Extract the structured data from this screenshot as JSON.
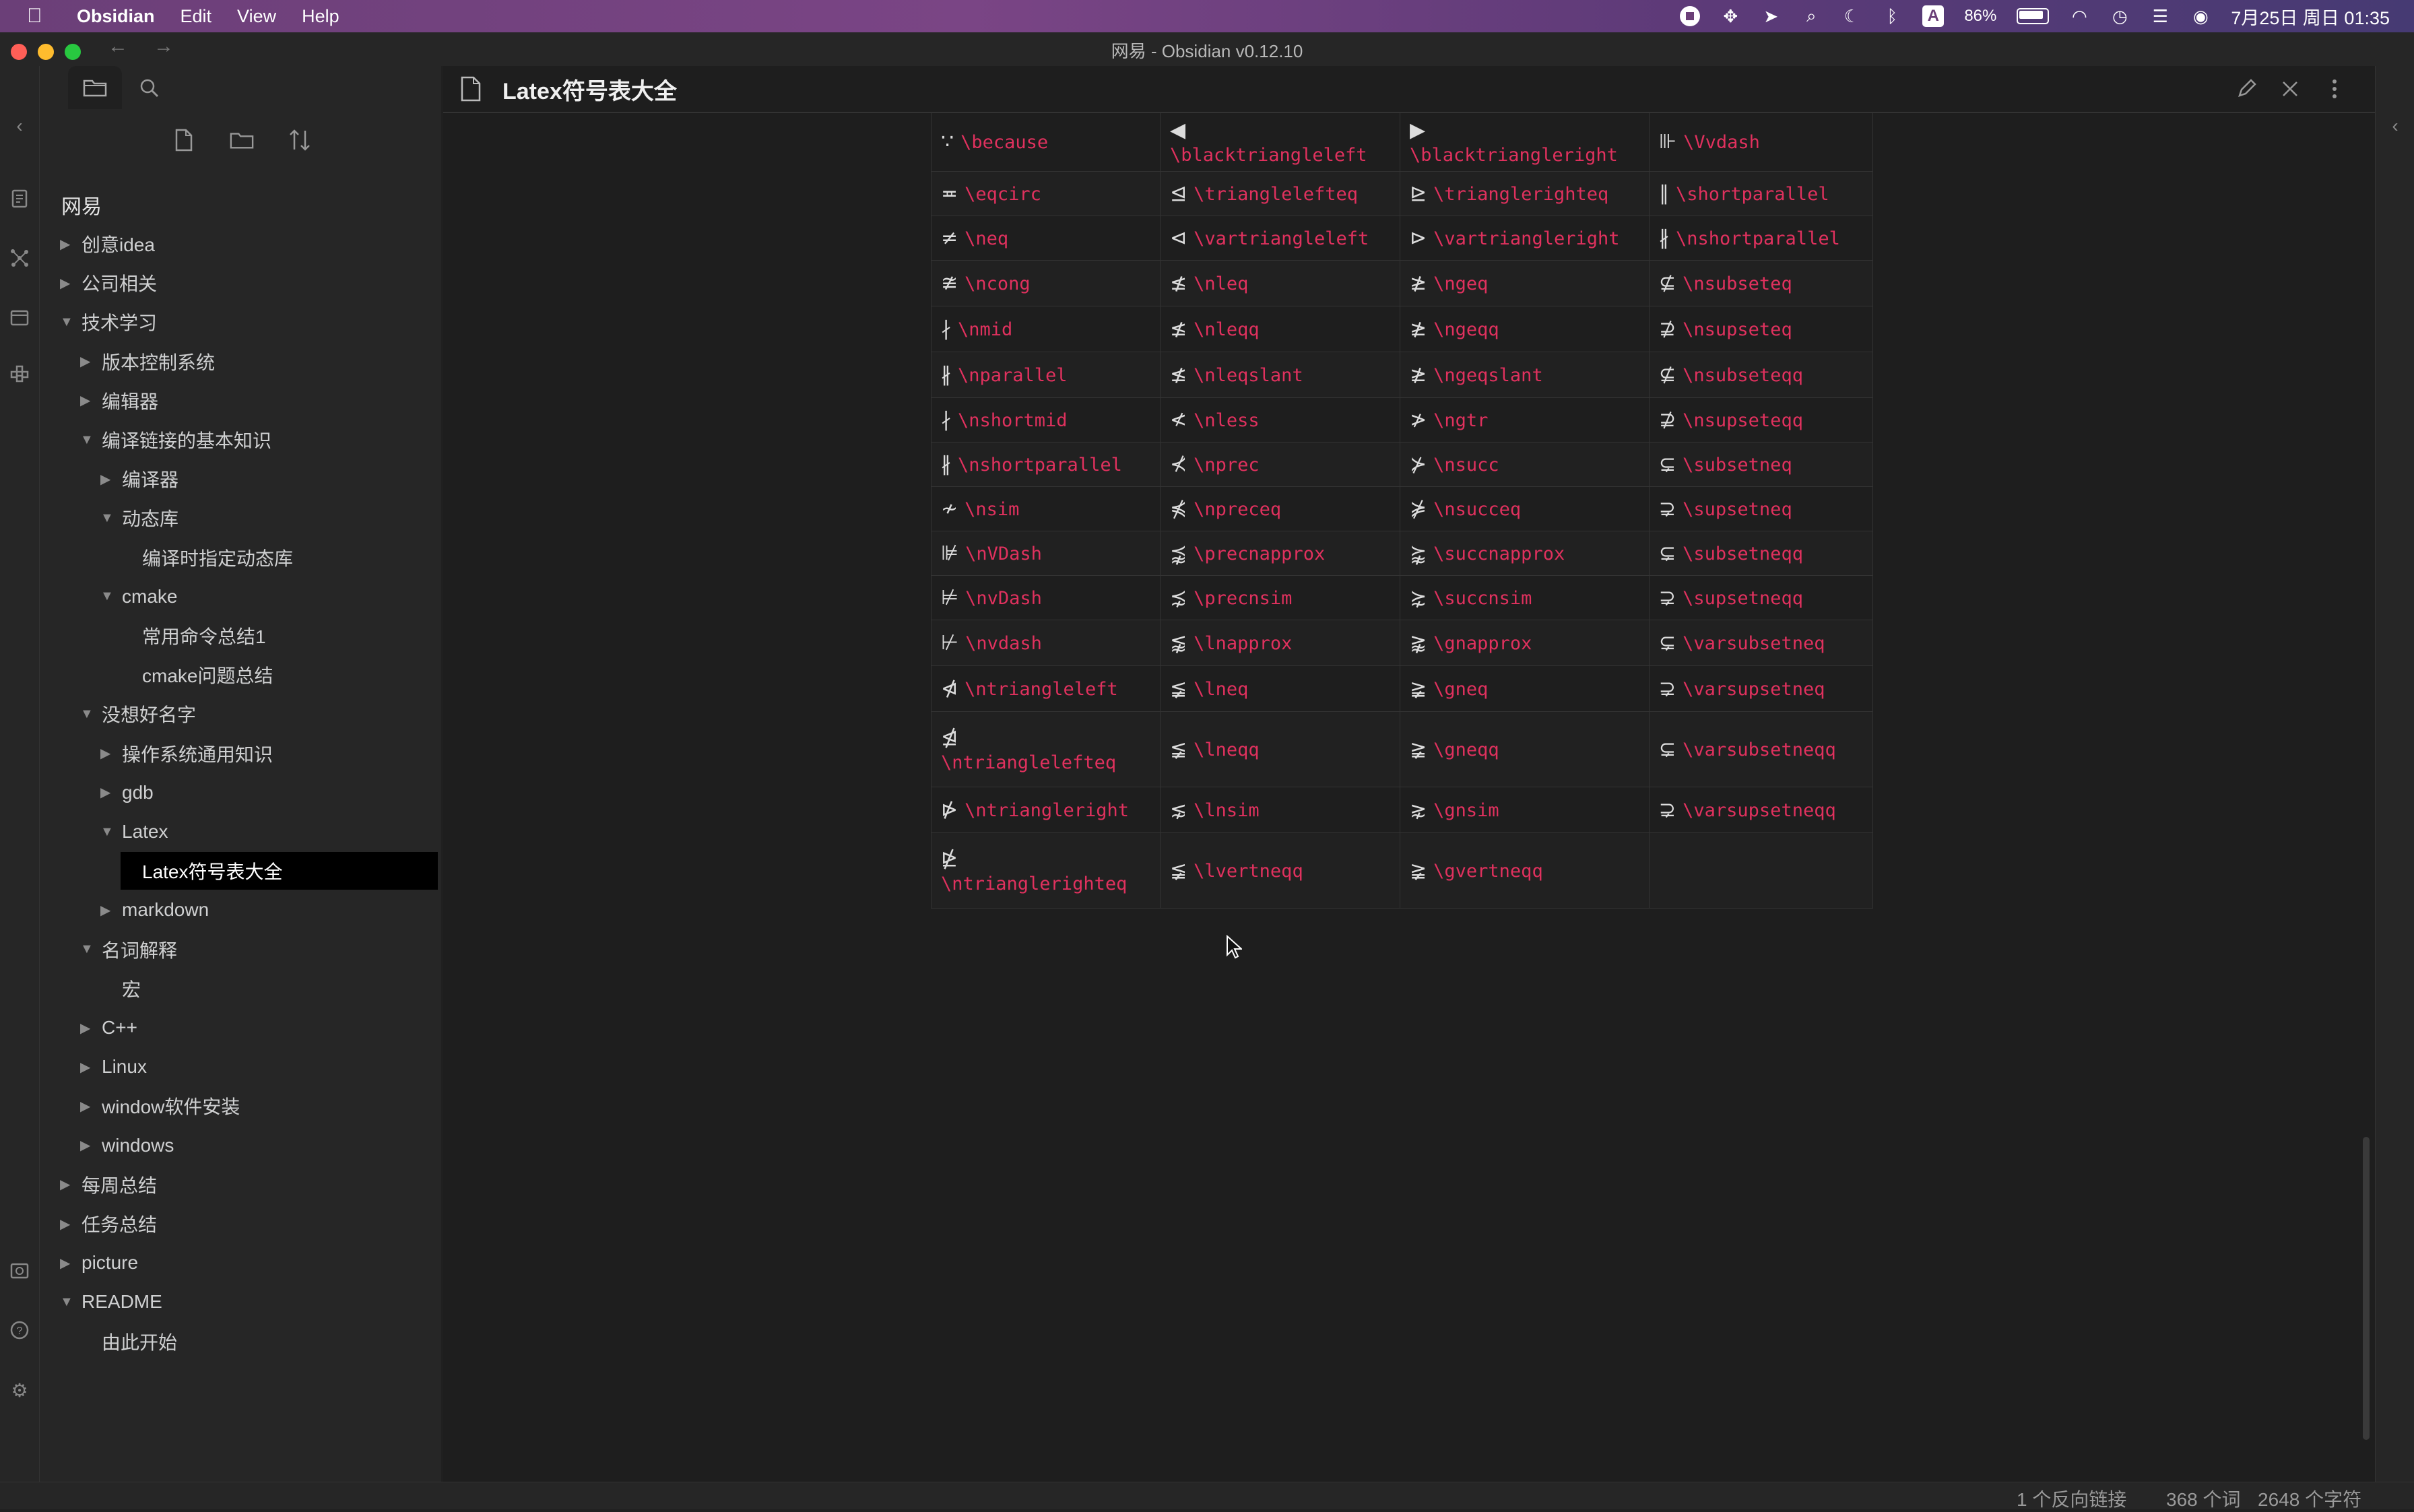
{
  "menubar": {
    "app_name": "Obsidian",
    "items": [
      "Edit",
      "View",
      "Help"
    ],
    "battery": "86%",
    "datetime": "7月25日 周日 01:35",
    "input_method": "A"
  },
  "window": {
    "title": "网易 - Obsidian v0.12.10"
  },
  "sidebar": {
    "vault_name": "网易",
    "tree": [
      {
        "label": "创意idea",
        "depth": 0,
        "arrow": "right"
      },
      {
        "label": "公司相关",
        "depth": 0,
        "arrow": "right"
      },
      {
        "label": "技术学习",
        "depth": 0,
        "arrow": "down"
      },
      {
        "label": "版本控制系统",
        "depth": 1,
        "arrow": "right"
      },
      {
        "label": "编辑器",
        "depth": 1,
        "arrow": "right"
      },
      {
        "label": "编译链接的基本知识",
        "depth": 1,
        "arrow": "down"
      },
      {
        "label": "编译器",
        "depth": 2,
        "arrow": "right"
      },
      {
        "label": "动态库",
        "depth": 2,
        "arrow": "down"
      },
      {
        "label": "编译时指定动态库",
        "depth": 3,
        "arrow": ""
      },
      {
        "label": "cmake",
        "depth": 2,
        "arrow": "down"
      },
      {
        "label": "常用命令总结1",
        "depth": 3,
        "arrow": ""
      },
      {
        "label": "cmake问题总结",
        "depth": 3,
        "arrow": ""
      },
      {
        "label": "没想好名字",
        "depth": 1,
        "arrow": "down"
      },
      {
        "label": "操作系统通用知识",
        "depth": 2,
        "arrow": "right"
      },
      {
        "label": "gdb",
        "depth": 2,
        "arrow": "right"
      },
      {
        "label": "Latex",
        "depth": 2,
        "arrow": "down"
      },
      {
        "label": "Latex符号表大全",
        "depth": 3,
        "arrow": "",
        "active": true
      },
      {
        "label": "markdown",
        "depth": 2,
        "arrow": "right"
      },
      {
        "label": "名词解释",
        "depth": 1,
        "arrow": "down"
      },
      {
        "label": "宏",
        "depth": 2,
        "arrow": ""
      },
      {
        "label": "C++",
        "depth": 1,
        "arrow": "right"
      },
      {
        "label": "Linux",
        "depth": 1,
        "arrow": "right"
      },
      {
        "label": "window软件安装",
        "depth": 1,
        "arrow": "right"
      },
      {
        "label": "windows",
        "depth": 1,
        "arrow": "right"
      },
      {
        "label": "每周总结",
        "depth": 0,
        "arrow": "right"
      },
      {
        "label": "任务总结",
        "depth": 0,
        "arrow": "right"
      },
      {
        "label": "picture",
        "depth": 0,
        "arrow": "right"
      },
      {
        "label": "README",
        "depth": 0,
        "arrow": "down"
      },
      {
        "label": "由此开始",
        "depth": 1,
        "arrow": ""
      }
    ]
  },
  "view": {
    "title": "Latex符号表大全"
  },
  "table": {
    "rows": [
      {
        "height": 88,
        "cells": [
          {
            "g": "∵",
            "c": "\\because"
          },
          {
            "g": "◀",
            "c": "\\blacktriangleleft",
            "stack": true
          },
          {
            "g": "▶",
            "c": "\\blacktriangleright",
            "stack": true
          },
          {
            "g": "⊪",
            "c": "\\Vvdash"
          }
        ]
      },
      {
        "height": 66,
        "cells": [
          {
            "g": "≖",
            "c": "\\eqcirc"
          },
          {
            "g": "⊴",
            "c": "\\trianglelefteq"
          },
          {
            "g": "⊵",
            "c": "\\trianglerighteq"
          },
          {
            "g": "∥",
            "c": "\\shortparallel"
          }
        ]
      },
      {
        "height": 66,
        "cells": [
          {
            "g": "≠",
            "c": "\\neq"
          },
          {
            "g": "⊲",
            "c": "\\vartriangleleft"
          },
          {
            "g": "⊳",
            "c": "\\vartriangleright"
          },
          {
            "g": "∦",
            "c": "\\nshortparallel"
          }
        ]
      },
      {
        "height": 68,
        "cells": [
          {
            "g": "≇",
            "c": "\\ncong"
          },
          {
            "g": "≰",
            "c": "\\nleq"
          },
          {
            "g": "≱",
            "c": "\\ngeq"
          },
          {
            "g": "⊈",
            "c": "\\nsubseteq"
          }
        ]
      },
      {
        "height": 68,
        "cells": [
          {
            "g": "∤",
            "c": "\\nmid"
          },
          {
            "g": "≰",
            "c": "\\nleqq"
          },
          {
            "g": "≱",
            "c": "\\ngeqq"
          },
          {
            "g": "⊉",
            "c": "\\nsupseteq"
          }
        ]
      },
      {
        "height": 68,
        "cells": [
          {
            "g": "∦",
            "c": "\\nparallel"
          },
          {
            "g": "≰",
            "c": "\\nleqslant"
          },
          {
            "g": "≱",
            "c": "\\ngeqslant"
          },
          {
            "g": "⊈",
            "c": "\\nsubseteqq"
          }
        ]
      },
      {
        "height": 66,
        "cells": [
          {
            "g": "∤",
            "c": "\\nshortmid"
          },
          {
            "g": "≮",
            "c": "\\nless"
          },
          {
            "g": "≯",
            "c": "\\ngtr"
          },
          {
            "g": "⊉",
            "c": "\\nsupseteqq"
          }
        ]
      },
      {
        "height": 66,
        "cells": [
          {
            "g": "∦",
            "c": "\\nshortparallel"
          },
          {
            "g": "⊀",
            "c": "\\nprec"
          },
          {
            "g": "⊁",
            "c": "\\nsucc"
          },
          {
            "g": "⊊",
            "c": "\\subsetneq"
          }
        ]
      },
      {
        "height": 66,
        "cells": [
          {
            "g": "≁",
            "c": "\\nsim"
          },
          {
            "g": "⋠",
            "c": "\\npreceq"
          },
          {
            "g": "⋡",
            "c": "\\nsucceq"
          },
          {
            "g": "⊋",
            "c": "\\supsetneq"
          }
        ]
      },
      {
        "height": 66,
        "cells": [
          {
            "g": "⊯",
            "c": "\\nVDash"
          },
          {
            "g": "⪹",
            "c": "\\precnapprox"
          },
          {
            "g": "⪺",
            "c": "\\succnapprox"
          },
          {
            "g": "⊊",
            "c": "\\subsetneqq"
          }
        ]
      },
      {
        "height": 66,
        "cells": [
          {
            "g": "⊭",
            "c": "\\nvDash"
          },
          {
            "g": "⋨",
            "c": "\\precnsim"
          },
          {
            "g": "⋩",
            "c": "\\succnsim"
          },
          {
            "g": "⊋",
            "c": "\\supsetneqq"
          }
        ]
      },
      {
        "height": 68,
        "cells": [
          {
            "g": "⊬",
            "c": "\\nvdash"
          },
          {
            "g": "⪉",
            "c": "\\lnapprox"
          },
          {
            "g": "⪊",
            "c": "\\gnapprox"
          },
          {
            "g": "⊊",
            "c": "\\varsubsetneq"
          }
        ]
      },
      {
        "height": 68,
        "cells": [
          {
            "g": "⋪",
            "c": "\\ntriangleleft"
          },
          {
            "g": "≨",
            "c": "\\lneq"
          },
          {
            "g": "≩",
            "c": "\\gneq"
          },
          {
            "g": "⊋",
            "c": "\\varsupsetneq"
          }
        ]
      },
      {
        "height": 112,
        "cells": [
          {
            "g": "⋬",
            "c": "\\ntrianglelefteq",
            "stack": true
          },
          {
            "g": "≨",
            "c": "\\lneqq"
          },
          {
            "g": "≩",
            "c": "\\gneqq"
          },
          {
            "g": "⊊",
            "c": "\\varsubsetneqq"
          }
        ]
      },
      {
        "height": 68,
        "cells": [
          {
            "g": "⋫",
            "c": "\\ntriangleright"
          },
          {
            "g": "⋦",
            "c": "\\lnsim"
          },
          {
            "g": "⋧",
            "c": "\\gnsim"
          },
          {
            "g": "⊋",
            "c": "\\varsupsetneqq"
          }
        ]
      },
      {
        "height": 112,
        "cells": [
          {
            "g": "⋭",
            "c": "\\ntrianglerighteq",
            "stack": true
          },
          {
            "g": "≨",
            "c": "\\lvertneqq"
          },
          {
            "g": "≩",
            "c": "\\gvertneqq"
          },
          {
            "g": "",
            "c": ""
          }
        ]
      }
    ]
  },
  "status": {
    "backlinks": "1 个反向链接",
    "words": "368 个词",
    "chars": "2648 个字符"
  },
  "icons": {
    "ribbon": [
      "collapse-left-icon",
      "open-quick-switcher-icon",
      "graph-view-icon",
      "open-today-icon",
      "templates-icon",
      "open-vault-icon",
      "help-icon",
      "settings-icon"
    ]
  },
  "colors": {
    "code_accent": "#e0315e",
    "background": "#1e1e1e",
    "sidebar_bg": "#262626",
    "active_item_bg": "#000000"
  }
}
